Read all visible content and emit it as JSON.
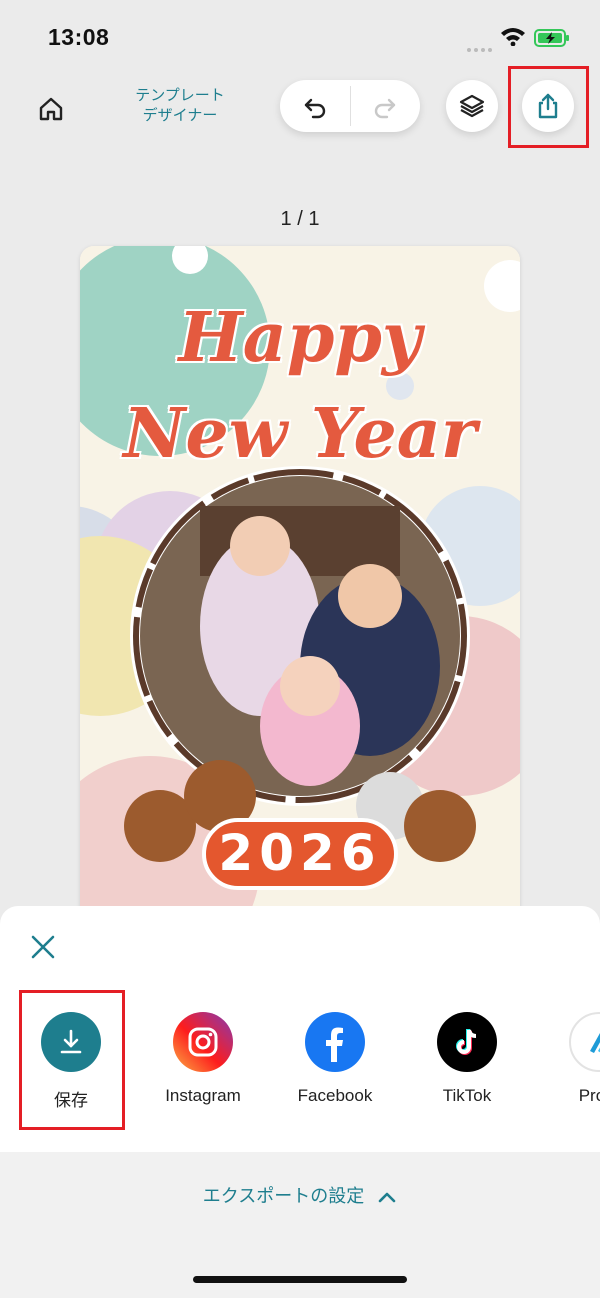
{
  "status_bar": {
    "time": "13:08"
  },
  "toolbar": {
    "app_title_line1": "テンプレート",
    "app_title_line2": "デザイナー"
  },
  "page_indicator": "1 / 1",
  "card": {
    "line1": "Happy",
    "line2": "New Year",
    "year": "2026"
  },
  "share_sheet": {
    "items": [
      {
        "label": "保存",
        "icon": "download-icon",
        "color": "#1e7e8e"
      },
      {
        "label": "Instagram",
        "icon": "instagram-icon"
      },
      {
        "label": "Facebook",
        "icon": "facebook-icon",
        "color": "#1877f2"
      },
      {
        "label": "TikTok",
        "icon": "tiktok-icon",
        "color": "#000000"
      },
      {
        "label": "Prom",
        "icon": "promeo-icon"
      }
    ],
    "export_settings_label": "エクスポートの設定"
  },
  "colors": {
    "accent": "#1e7e8e",
    "highlight": "#e41e25"
  }
}
